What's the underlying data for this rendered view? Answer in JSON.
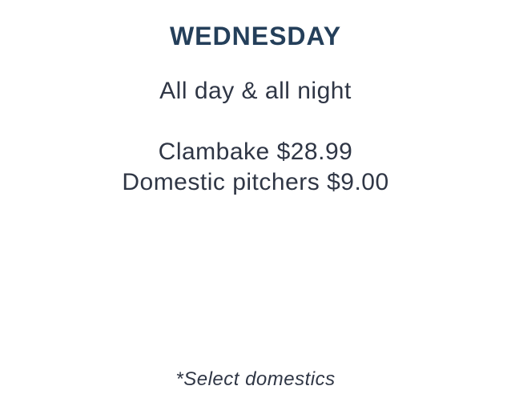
{
  "day": {
    "title": "WEDNESDAY",
    "timeframe": "All day & all night"
  },
  "specials": [
    "Clambake $28.99",
    "Domestic pitchers $9.00"
  ],
  "footnote": "*Select domestics",
  "colors": {
    "title": "#243f5a",
    "text": "#2f3645",
    "background": "#ffffff"
  }
}
